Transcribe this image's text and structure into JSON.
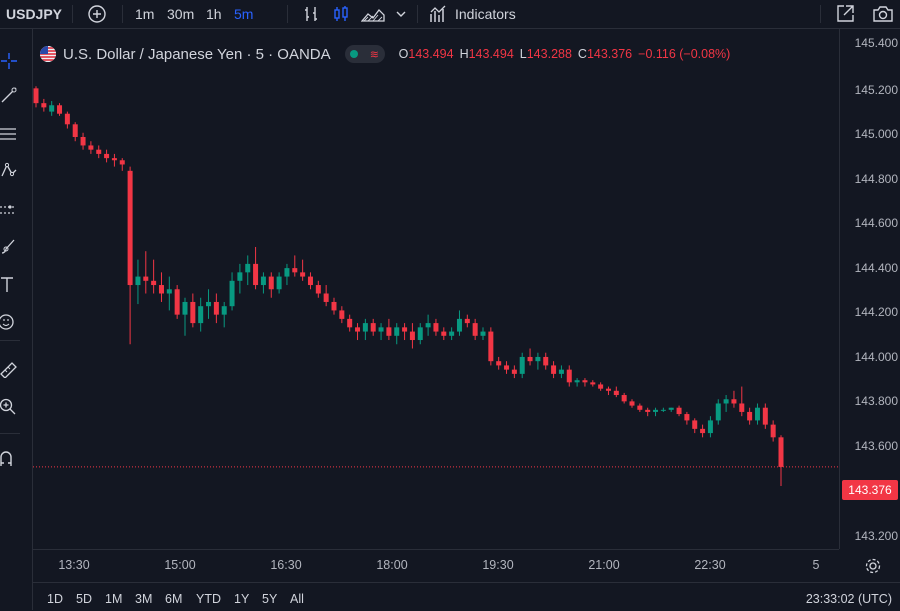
{
  "toolbar": {
    "symbol": "USDJPY",
    "intervals": [
      "1m",
      "30m",
      "1h",
      "5m"
    ],
    "active_interval": "5m",
    "indicators_label": "Indicators",
    "icons": [
      "plus-circle-icon",
      "bar-style-icon",
      "candle-style-icon",
      "area-style-icon",
      "chevron-down-icon",
      "indicators-icon",
      "snapshot-icon",
      "camera-icon"
    ]
  },
  "left_tools": [
    "crosshair-icon",
    "trendline-icon",
    "fib-icon",
    "pattern-icon",
    "forecast-icon",
    "brush-icon",
    "text-icon",
    "emoji-icon",
    "ruler-icon",
    "zoom-icon",
    "magnet-icon"
  ],
  "legend": {
    "title": "U.S. Dollar / Japanese Yen · 5 · OANDA",
    "o_label": "O",
    "o": "143.494",
    "h_label": "H",
    "h": "143.494",
    "l_label": "L",
    "l": "143.288",
    "c_label": "C",
    "c": "143.376",
    "change": "−0.116 (−0.08%)"
  },
  "price_axis": {
    "labels": [
      "145.400",
      "145.200",
      "145.000",
      "144.800",
      "144.600",
      "144.400",
      "144.200",
      "144.000",
      "143.800",
      "143.600",
      "143.400",
      "143.200"
    ],
    "current": "143.376"
  },
  "time_axis": {
    "labels": [
      "13:30",
      "15:00",
      "16:30",
      "18:00",
      "19:30",
      "21:00",
      "22:30",
      "5"
    ]
  },
  "bottom": {
    "ranges": [
      "1D",
      "5D",
      "1M",
      "3M",
      "6M",
      "YTD",
      "1Y",
      "5Y",
      "All"
    ],
    "clock": "23:33:02 (UTC)"
  },
  "colors": {
    "up": "#089981",
    "down": "#f23645",
    "bg": "#131722",
    "accent": "#2962ff"
  },
  "chart_data": {
    "type": "candlestick",
    "ylim": [
      143.12,
      145.42
    ],
    "candles": [
      [
        145.17,
        145.18,
        145.08,
        145.1
      ],
      [
        145.1,
        145.12,
        145.06,
        145.08
      ],
      [
        145.06,
        145.11,
        145.04,
        145.09
      ],
      [
        145.09,
        145.1,
        145.04,
        145.05
      ],
      [
        145.05,
        145.06,
        144.98,
        145.0
      ],
      [
        145.0,
        145.01,
        144.92,
        144.94
      ],
      [
        144.94,
        144.96,
        144.88,
        144.9
      ],
      [
        144.9,
        144.92,
        144.86,
        144.88
      ],
      [
        144.88,
        144.9,
        144.84,
        144.86
      ],
      [
        144.86,
        144.88,
        144.82,
        144.84
      ],
      [
        144.84,
        144.86,
        144.8,
        144.83
      ],
      [
        144.83,
        144.84,
        144.78,
        144.81
      ],
      [
        144.78,
        144.8,
        143.96,
        144.24
      ],
      [
        144.24,
        144.36,
        144.15,
        144.28
      ],
      [
        144.28,
        144.4,
        144.2,
        144.26
      ],
      [
        144.26,
        144.36,
        144.2,
        144.24
      ],
      [
        144.24,
        144.3,
        144.16,
        144.2
      ],
      [
        144.2,
        144.28,
        144.12,
        144.22
      ],
      [
        144.22,
        144.24,
        144.08,
        144.1
      ],
      [
        144.1,
        144.18,
        144.0,
        144.16
      ],
      [
        144.16,
        144.2,
        144.04,
        144.06
      ],
      [
        144.06,
        144.18,
        144.02,
        144.14
      ],
      [
        144.14,
        144.22,
        144.08,
        144.16
      ],
      [
        144.16,
        144.2,
        144.06,
        144.1
      ],
      [
        144.1,
        144.16,
        144.04,
        144.14
      ],
      [
        144.14,
        144.3,
        144.12,
        144.26
      ],
      [
        144.26,
        144.34,
        144.2,
        144.3
      ],
      [
        144.3,
        144.38,
        144.24,
        144.34
      ],
      [
        144.34,
        144.42,
        144.22,
        144.24
      ],
      [
        144.24,
        144.3,
        144.2,
        144.28
      ],
      [
        144.28,
        144.3,
        144.18,
        144.22
      ],
      [
        144.22,
        144.3,
        144.2,
        144.28
      ],
      [
        144.28,
        144.34,
        144.24,
        144.32
      ],
      [
        144.32,
        144.38,
        144.28,
        144.3
      ],
      [
        144.3,
        144.36,
        144.26,
        144.28
      ],
      [
        144.28,
        144.3,
        144.22,
        144.24
      ],
      [
        144.24,
        144.26,
        144.18,
        144.2
      ],
      [
        144.2,
        144.24,
        144.14,
        144.16
      ],
      [
        144.16,
        144.18,
        144.1,
        144.12
      ],
      [
        144.12,
        144.14,
        144.06,
        144.08
      ],
      [
        144.08,
        144.1,
        144.02,
        144.04
      ],
      [
        144.04,
        144.06,
        143.98,
        144.02
      ],
      [
        144.02,
        144.08,
        143.98,
        144.06
      ],
      [
        144.06,
        144.08,
        144.0,
        144.02
      ],
      [
        144.02,
        144.06,
        143.98,
        144.04
      ],
      [
        144.04,
        144.08,
        143.98,
        144.0
      ],
      [
        144.0,
        144.06,
        143.96,
        144.04
      ],
      [
        144.04,
        144.06,
        143.98,
        144.02
      ],
      [
        144.02,
        144.06,
        143.94,
        143.98
      ],
      [
        143.98,
        144.06,
        143.96,
        144.04
      ],
      [
        144.04,
        144.1,
        144.0,
        144.06
      ],
      [
        144.06,
        144.08,
        144.0,
        144.02
      ],
      [
        144.02,
        144.04,
        143.98,
        144.0
      ],
      [
        144.0,
        144.04,
        143.98,
        144.02
      ],
      [
        144.02,
        144.12,
        144.0,
        144.08
      ],
      [
        144.08,
        144.1,
        144.04,
        144.06
      ],
      [
        144.06,
        144.08,
        143.98,
        144.0
      ],
      [
        144.0,
        144.04,
        143.98,
        144.02
      ],
      [
        144.02,
        144.04,
        143.86,
        143.88
      ],
      [
        143.88,
        143.9,
        143.84,
        143.86
      ],
      [
        143.86,
        143.88,
        143.82,
        143.84
      ],
      [
        143.84,
        143.86,
        143.8,
        143.82
      ],
      [
        143.82,
        143.92,
        143.8,
        143.9
      ],
      [
        143.9,
        143.94,
        143.86,
        143.88
      ],
      [
        143.88,
        143.92,
        143.84,
        143.9
      ],
      [
        143.9,
        143.92,
        143.84,
        143.86
      ],
      [
        143.86,
        143.88,
        143.8,
        143.82
      ],
      [
        143.82,
        143.86,
        143.8,
        143.84
      ],
      [
        143.84,
        143.86,
        143.76,
        143.78
      ],
      [
        143.78,
        143.8,
        143.76,
        143.79
      ],
      [
        143.79,
        143.8,
        143.76,
        143.78
      ],
      [
        143.78,
        143.79,
        143.76,
        143.77
      ],
      [
        143.77,
        143.78,
        143.74,
        143.75
      ],
      [
        143.75,
        143.76,
        143.72,
        143.74
      ],
      [
        143.74,
        143.76,
        143.71,
        143.72
      ],
      [
        143.72,
        143.73,
        143.68,
        143.69
      ],
      [
        143.69,
        143.7,
        143.66,
        143.67
      ],
      [
        143.67,
        143.68,
        143.64,
        143.65
      ],
      [
        143.65,
        143.66,
        143.62,
        143.64
      ],
      [
        143.64,
        143.66,
        143.62,
        143.65
      ],
      [
        143.65,
        143.66,
        143.64,
        143.65
      ],
      [
        143.65,
        143.66,
        143.64,
        143.66
      ],
      [
        143.66,
        143.67,
        143.62,
        143.63
      ],
      [
        143.63,
        143.64,
        143.58,
        143.6
      ],
      [
        143.6,
        143.61,
        143.54,
        143.56
      ],
      [
        143.56,
        143.58,
        143.52,
        143.54
      ],
      [
        143.54,
        143.62,
        143.52,
        143.6
      ],
      [
        143.6,
        143.7,
        143.58,
        143.68
      ],
      [
        143.68,
        143.72,
        143.64,
        143.7
      ],
      [
        143.7,
        143.74,
        143.66,
        143.68
      ],
      [
        143.68,
        143.76,
        143.62,
        143.64
      ],
      [
        143.64,
        143.66,
        143.58,
        143.6
      ],
      [
        143.6,
        143.68,
        143.58,
        143.66
      ],
      [
        143.66,
        143.68,
        143.56,
        143.58
      ],
      [
        143.58,
        143.6,
        143.5,
        143.52
      ],
      [
        143.52,
        143.53,
        143.29,
        143.38
      ]
    ]
  }
}
